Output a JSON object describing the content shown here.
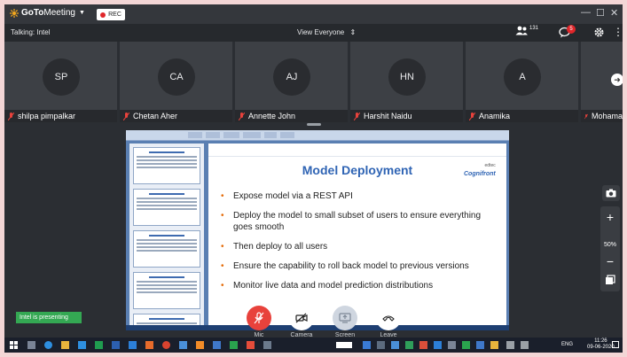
{
  "app": {
    "brand_bold": "GoTo",
    "brand_rest": "Meeting",
    "rec_label": "REC"
  },
  "toolbar": {
    "talking": "Talking: Intel",
    "view": "View Everyone",
    "people_count": "131",
    "chat_badge": "5"
  },
  "participants": [
    {
      "initials": "SP",
      "name": "shilpa pimpalkar"
    },
    {
      "initials": "CA",
      "name": "Chetan Aher"
    },
    {
      "initials": "AJ",
      "name": "Annette John"
    },
    {
      "initials": "HN",
      "name": "Harshit Naidu"
    },
    {
      "initials": "A",
      "name": "Anamika"
    },
    {
      "initials": "",
      "name": "Mohama"
    }
  ],
  "slide": {
    "title": "Model Deployment",
    "logo_top": "edtec",
    "logo_name": "Cognifront",
    "bullets": [
      "Expose model via a REST API",
      "Deploy the model to small subset of users to ensure everything goes smooth",
      "Then deploy to all users",
      "Ensure the capability to roll back model to previous versions",
      "Monitor live data and model prediction distributions"
    ]
  },
  "presenting": "Intel is presenting",
  "zoom": {
    "level": "50%",
    "plus": "+",
    "minus": "−"
  },
  "controls": {
    "mic": "Mic",
    "camera": "Camera",
    "screen": "Screen",
    "leave": "Leave"
  },
  "taskbar": {
    "lang": "ENG",
    "time": "11:26",
    "date": "09-06-2020"
  },
  "colors": {
    "mic_red": "#e8423c",
    "rec_dot": "#e0262a",
    "present_green": "#34a853",
    "slide_title_blue": "#2f64b4",
    "bullet_orange": "#e46c0a"
  }
}
